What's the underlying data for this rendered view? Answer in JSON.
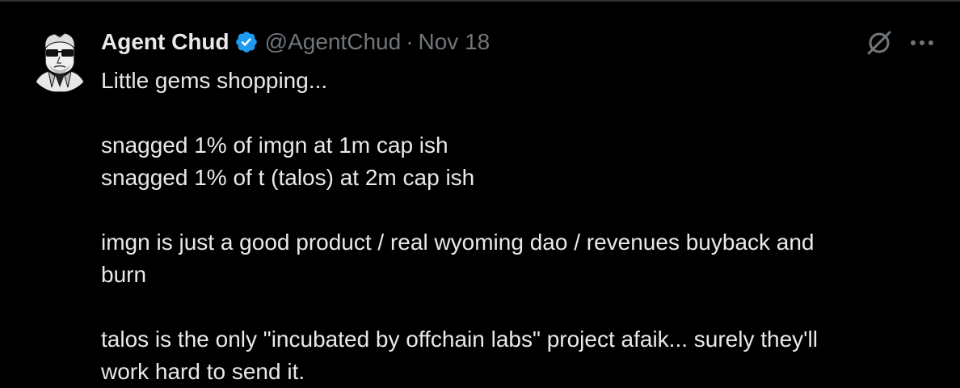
{
  "tweet": {
    "author_name": "Agent Chud",
    "handle": "@AgentChud",
    "separator": "·",
    "date": "Nov 18",
    "lines": [
      "Little gems shopping...",
      "",
      "snagged 1% of imgn at 1m cap ish",
      "snagged 1% of t (talos) at 2m cap ish",
      "",
      "imgn is just a good product / real wyoming dao / revenues buyback and",
      "burn",
      "",
      "talos is the only \"incubated by offchain labs\" project afaik... surely they'll",
      "work hard to send it."
    ]
  },
  "icons": {
    "avatar": "agent-chud-avatar",
    "verified": "verified-badge-icon",
    "grok": "grok-icon",
    "more": "more-options-icon"
  },
  "colors": {
    "background": "#000000",
    "text_primary": "#e7e9ea",
    "text_secondary": "#71767b",
    "verified_blue": "#1d9bf0",
    "divider": "#2f3336"
  }
}
